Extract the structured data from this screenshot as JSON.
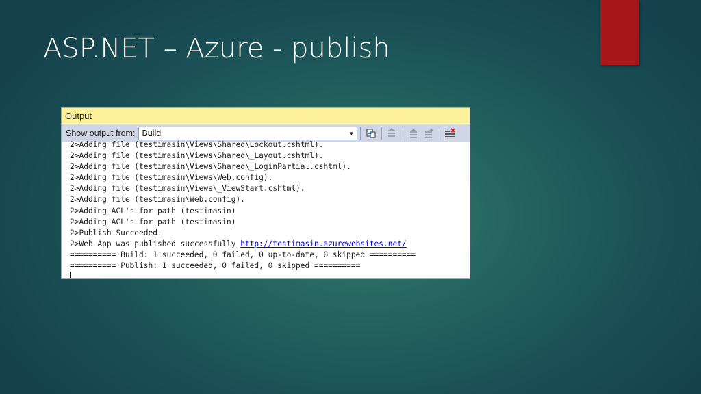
{
  "slide": {
    "title": "ASP.NET – Azure - publish"
  },
  "panel": {
    "title": "Output",
    "show_output_label": "Show output from:",
    "source_selected": "Build",
    "toolbar_icons": [
      "go-to-source-icon",
      "previous-message-icon",
      "next-message-icon",
      "find-message-icon",
      "clear-all-icon"
    ]
  },
  "output": {
    "lines": [
      "2>Adding file (testimasin\\Views\\Shared\\Lockout.cshtml).",
      "2>Adding file (testimasin\\Views\\Shared\\_Layout.cshtml).",
      "2>Adding file (testimasin\\Views\\Shared\\_LoginPartial.cshtml).",
      "2>Adding file (testimasin\\Views\\Web.config).",
      "2>Adding file (testimasin\\Views\\_ViewStart.cshtml).",
      "2>Adding file (testimasin\\Web.config).",
      "2>Adding ACL's for path (testimasin)",
      "2>Adding ACL's for path (testimasin)",
      "2>Publish Succeeded."
    ],
    "published_prefix": "2>Web App was published successfully ",
    "published_url": "http://testimasin.azurewebsites.net/",
    "summary_build": "========== Build: 1 succeeded, 0 failed, 0 up-to-date, 0 skipped ==========",
    "summary_publish": "========== Publish: 1 succeeded, 0 failed, 0 skipped =========="
  },
  "colors": {
    "accent": "#a8171a",
    "header": "#fff29d",
    "toolbar": "#cfd6e5",
    "link": "#0000ee"
  }
}
